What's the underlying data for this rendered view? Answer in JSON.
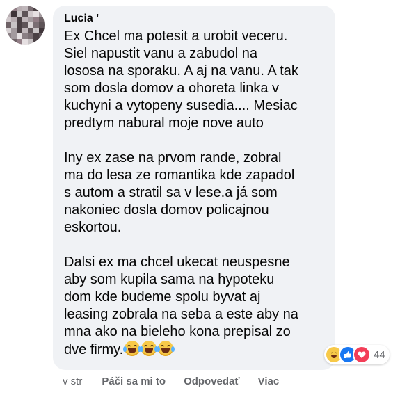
{
  "comment": {
    "author": "Lucia '",
    "paragraphs": [
      "Ex Chcel ma potesit a urobit veceru.\nSiel napustit vanu a zabudol na\nlososa na sporaku. A aj na vanu. A tak\nsom dosla domov a ohoreta linka v\nkuchyni a vytopeny susedia.... Mesiac\npredtym nabural moje nove auto",
      "Iny ex zase na prvom rande, zobral\nma do lesa ze romantika kde zapadol\ns autom a stratil sa v lese.a já som\nnakoniec dosla domov policajnou\neskortou.",
      "Dalsi ex ma chcel ukecat neuspesne\naby som kupila sama na hypoteku\ndom kde budeme spolu byvat aj\nleasing zobrala na seba a este aby na\nmna ako na bieleho kona prepisal zo\ndve firmy."
    ],
    "trailing_emojis": [
      "face-with-tears-of-joy-icon",
      "face-with-tears-of-joy-icon",
      "face-with-tears-of-joy-icon"
    ]
  },
  "reactions": {
    "icons": [
      "haha-reaction-icon",
      "like-reaction-icon",
      "love-reaction-icon"
    ],
    "count": "44"
  },
  "actions": {
    "time": "v str",
    "like": "Páči sa mi to",
    "reply": "Odpovedať",
    "more": "Viac"
  },
  "colors": {
    "bubble": "#f0f2f5",
    "text": "#050505",
    "meta": "#65676b",
    "like_blue": "#1877f2",
    "love_red": "#f33e58",
    "haha_yellow": "#f7c948"
  }
}
